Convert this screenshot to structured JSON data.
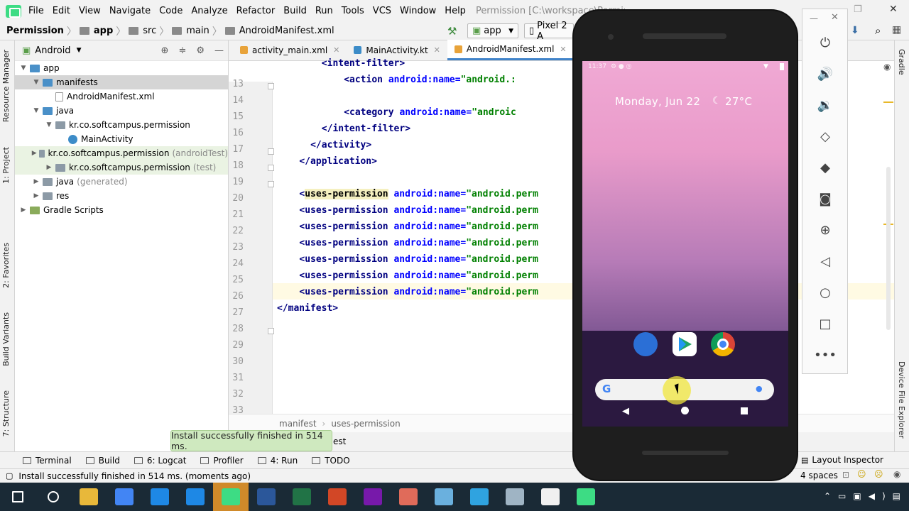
{
  "menubar": {
    "items": [
      "File",
      "Edit",
      "View",
      "Navigate",
      "Code",
      "Analyze",
      "Refactor",
      "Build",
      "Run",
      "Tools",
      "VCS",
      "Window",
      "Help"
    ],
    "title": "Permission [C:\\workspace\\Permission] - ...\\app\\src\\main\\AndroidManifest.xml ..."
  },
  "navbar": {
    "crumbs": [
      "Permission",
      "app",
      "src",
      "main",
      "AndroidManifest.xml"
    ],
    "run_config": "app",
    "device": "Pixel 2 A"
  },
  "left_strip": {
    "tabs": [
      "1: Project",
      "Resource Manager",
      "2: Favorites",
      "Build Variants",
      "7: Structure"
    ]
  },
  "right_strip": {
    "tabs": [
      "Gradle",
      "Device File Explorer"
    ]
  },
  "project": {
    "view": "Android",
    "tree": [
      {
        "label": "app",
        "extra": "",
        "indent": 0,
        "arrow": "▼",
        "icon": "blue"
      },
      {
        "label": "manifests",
        "extra": "",
        "indent": 1,
        "arrow": "▼",
        "icon": "blue",
        "selected": true
      },
      {
        "label": "AndroidManifest.xml",
        "extra": "",
        "indent": 2,
        "arrow": "",
        "icon": "file"
      },
      {
        "label": "java",
        "extra": "",
        "indent": 1,
        "arrow": "▼",
        "icon": "blue"
      },
      {
        "label": "kr.co.softcampus.permission",
        "extra": "",
        "indent": 2,
        "arrow": "▼",
        "icon": "gray"
      },
      {
        "label": "MainActivity",
        "extra": "",
        "indent": 3,
        "arrow": "",
        "icon": "kt"
      },
      {
        "label": "kr.co.softcampus.permission",
        "extra": "(androidTest)",
        "indent": 2,
        "arrow": "▶",
        "icon": "gray",
        "hl": true
      },
      {
        "label": "kr.co.softcampus.permission",
        "extra": "(test)",
        "indent": 2,
        "arrow": "▶",
        "icon": "gray",
        "hl": true
      },
      {
        "label": "java",
        "extra": "(generated)",
        "indent": 1,
        "arrow": "▶",
        "icon": "gray"
      },
      {
        "label": "res",
        "extra": "",
        "indent": 1,
        "arrow": "▶",
        "icon": "gray"
      },
      {
        "label": "Gradle Scripts",
        "extra": "",
        "indent": 0,
        "arrow": "▶",
        "icon": "green"
      }
    ]
  },
  "editor": {
    "tabs": [
      {
        "label": "activity_main.xml",
        "active": false
      },
      {
        "label": "MainActivity.kt",
        "active": false
      },
      {
        "label": "AndroidManifest.xml",
        "active": true
      }
    ],
    "lines": [
      {
        "n": "13",
        "indent": 8,
        "parts": [
          [
            "tag",
            "<intent-filter>"
          ]
        ]
      },
      {
        "n": "14",
        "indent": 12,
        "parts": [
          [
            "tag",
            "<action "
          ],
          [
            "attr",
            "android:name="
          ],
          [
            "val",
            "\"android.:"
          ]
        ]
      },
      {
        "n": "15",
        "indent": 0,
        "parts": []
      },
      {
        "n": "16",
        "indent": 12,
        "parts": [
          [
            "tag",
            "<category "
          ],
          [
            "attr",
            "android:name="
          ],
          [
            "val",
            "\"androic"
          ]
        ]
      },
      {
        "n": "17",
        "indent": 8,
        "parts": [
          [
            "tag",
            "</intent-filter>"
          ]
        ]
      },
      {
        "n": "18",
        "indent": 6,
        "parts": [
          [
            "tag",
            "</activity>"
          ]
        ]
      },
      {
        "n": "19",
        "indent": 4,
        "parts": [
          [
            "tag",
            "</application>"
          ]
        ]
      },
      {
        "n": "20",
        "indent": 0,
        "parts": []
      },
      {
        "n": "21",
        "indent": 4,
        "parts": [
          [
            "tag",
            "<"
          ],
          [
            "ktag",
            "uses-permission"
          ],
          [
            "attr",
            " android:name="
          ],
          [
            "val",
            "\"android.perm"
          ]
        ]
      },
      {
        "n": "22",
        "indent": 4,
        "parts": [
          [
            "tag",
            "<uses-permission "
          ],
          [
            "attr",
            "android:name="
          ],
          [
            "val",
            "\"android.perm"
          ]
        ]
      },
      {
        "n": "23",
        "indent": 4,
        "parts": [
          [
            "tag",
            "<uses-permission "
          ],
          [
            "attr",
            "android:name="
          ],
          [
            "val",
            "\"android.perm"
          ]
        ]
      },
      {
        "n": "24",
        "indent": 4,
        "parts": [
          [
            "tag",
            "<uses-permission "
          ],
          [
            "attr",
            "android:name="
          ],
          [
            "val",
            "\"android.perm"
          ]
        ]
      },
      {
        "n": "25",
        "indent": 4,
        "parts": [
          [
            "tag",
            "<uses-permission "
          ],
          [
            "attr",
            "android:name="
          ],
          [
            "val",
            "\"android.perm"
          ]
        ]
      },
      {
        "n": "26",
        "indent": 4,
        "parts": [
          [
            "tag",
            "<uses-permission "
          ],
          [
            "attr",
            "android:name="
          ],
          [
            "val",
            "\"android.perm"
          ]
        ]
      },
      {
        "n": "27",
        "indent": 4,
        "parts": [
          [
            "tag",
            "<uses-permission "
          ],
          [
            "attr",
            "android:name="
          ],
          [
            "val",
            "\"android.perm"
          ]
        ]
      },
      {
        "n": "28",
        "indent": 0,
        "parts": [
          [
            "tag",
            "</manifest>"
          ]
        ]
      },
      {
        "n": "29",
        "indent": 0,
        "parts": []
      },
      {
        "n": "30",
        "indent": 0,
        "parts": []
      },
      {
        "n": "31",
        "indent": 0,
        "parts": []
      },
      {
        "n": "32",
        "indent": 0,
        "parts": []
      },
      {
        "n": "33",
        "indent": 0,
        "parts": []
      },
      {
        "n": "34",
        "indent": 0,
        "parts": []
      }
    ],
    "breadcrumb": [
      "manifest",
      "uses-permission"
    ]
  },
  "toast": "Install successfully finished in 514 ms.",
  "run_tab_fragment": "est",
  "toolwindows": [
    {
      "label": "Terminal"
    },
    {
      "label": "Build"
    },
    {
      "label": "6: Logcat"
    },
    {
      "label": "Profiler"
    },
    {
      "label": "4: Run"
    },
    {
      "label": "TODO"
    }
  ],
  "layout_inspector": "Layout Inspector",
  "status": {
    "message": "Install successfully finished in 514 ms. (moments ago)",
    "indent": "4 spaces"
  },
  "phone": {
    "statusbar_time": "11:37",
    "date": "Monday, Jun 22",
    "weather": "27°C",
    "search_logo": "G"
  },
  "emulator": {
    "buttons": [
      "power-icon",
      "volume-up-icon",
      "volume-down-icon",
      "rotate-left-icon",
      "rotate-right-icon",
      "camera-icon",
      "zoom-icon",
      "back-icon",
      "home-icon",
      "overview-icon",
      "more-icon"
    ]
  },
  "taskbar": {
    "apps": [
      "windows-start-icon",
      "search-icon",
      "file-explorer-icon",
      "chrome-icon",
      "edge-icon",
      "ie-icon",
      "android-studio-icon",
      "word-icon",
      "excel-icon",
      "powerpoint-icon",
      "onenote-icon",
      "app-icon",
      "app-icon",
      "photoshop-icon",
      "app-icon",
      "app-icon",
      "app-icon"
    ]
  },
  "colors": {
    "accent": "#4083c9",
    "toast_bg": "#cfe9bf",
    "taskbar": "#1a2a36"
  }
}
